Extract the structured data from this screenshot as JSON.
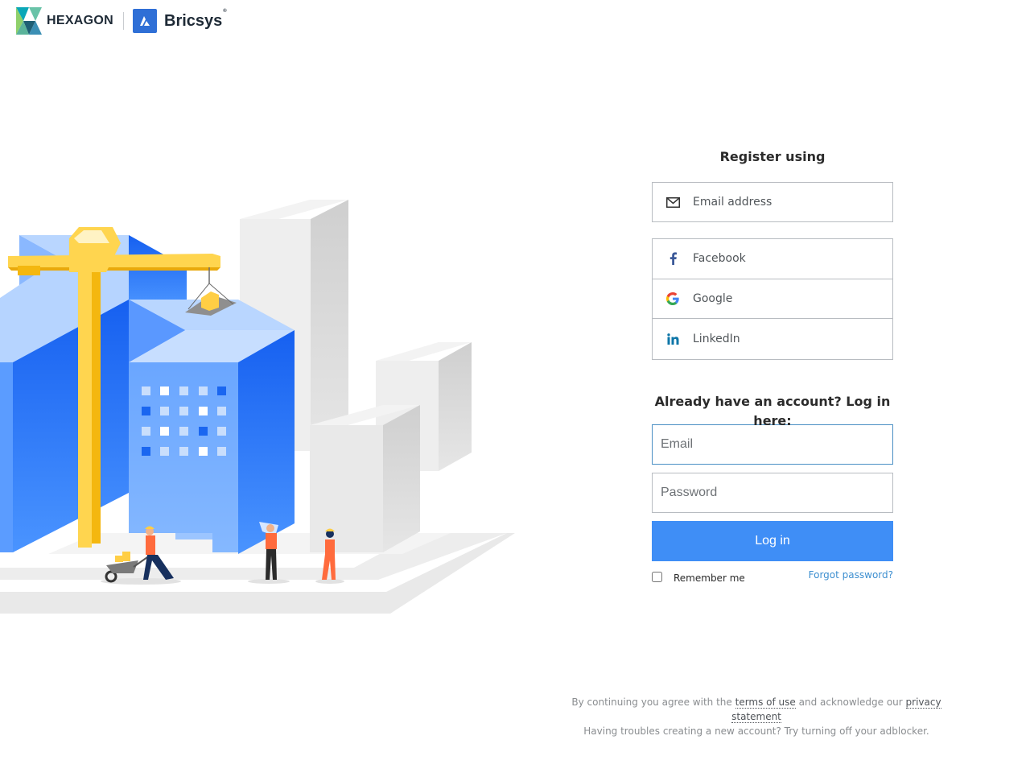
{
  "brand": {
    "hexagon": "HEXAGON",
    "bricsys": "Bricsys",
    "trademark": "®"
  },
  "register": {
    "title": "Register using",
    "email_label": "Email address",
    "social": [
      {
        "label": "Facebook",
        "icon": "facebook-icon"
      },
      {
        "label": "Google",
        "icon": "google-icon"
      },
      {
        "label": "LinkedIn",
        "icon": "linkedin-icon"
      }
    ]
  },
  "login": {
    "title": "Already have an account? Log in here:",
    "email_placeholder": "Email",
    "password_placeholder": "Password",
    "button": "Log in",
    "remember": "Remember me",
    "forgot": "Forgot password?"
  },
  "footer": {
    "line1_pre": "By continuing you agree with the",
    "terms": "terms of use",
    "line1_mid": "and acknowledge our",
    "privacy": "privacy statement",
    "line2": "Having troubles creating a new account? Try turning off your adblocker."
  },
  "colors": {
    "accent": "#3f8ef6",
    "link": "#3d8fd0",
    "building_blue": "#1f6ff2",
    "crane_yellow": "#ffce45"
  }
}
